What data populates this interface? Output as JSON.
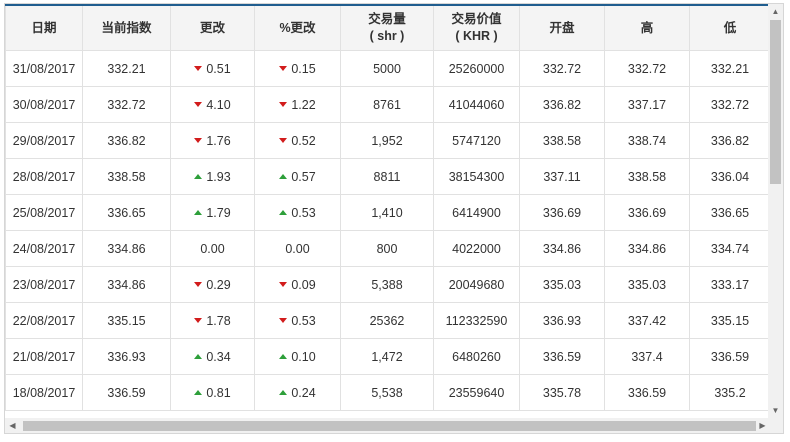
{
  "columns": [
    {
      "line1": "日期",
      "line2": ""
    },
    {
      "line1": "当前指数",
      "line2": ""
    },
    {
      "line1": "更改",
      "line2": ""
    },
    {
      "line1": "%更改",
      "line2": ""
    },
    {
      "line1": "交易量",
      "line2": "( shr )"
    },
    {
      "line1": "交易价值",
      "line2": "( KHR )"
    },
    {
      "line1": "开盘",
      "line2": ""
    },
    {
      "line1": "高",
      "line2": ""
    },
    {
      "line1": "低",
      "line2": ""
    }
  ],
  "rows": [
    {
      "date": "31/08/2017",
      "index": "332.21",
      "dir": "down",
      "change": "0.51",
      "pct": "0.15",
      "volume": "5000",
      "value": "25260000",
      "open": "332.72",
      "high": "332.72",
      "low": "332.21"
    },
    {
      "date": "30/08/2017",
      "index": "332.72",
      "dir": "down",
      "change": "4.10",
      "pct": "1.22",
      "volume": "8761",
      "value": "41044060",
      "open": "336.82",
      "high": "337.17",
      "low": "332.72"
    },
    {
      "date": "29/08/2017",
      "index": "336.82",
      "dir": "down",
      "change": "1.76",
      "pct": "0.52",
      "volume": "1,952",
      "value": "5747120",
      "open": "338.58",
      "high": "338.74",
      "low": "336.82"
    },
    {
      "date": "28/08/2017",
      "index": "338.58",
      "dir": "up",
      "change": "1.93",
      "pct": "0.57",
      "volume": "8811",
      "value": "38154300",
      "open": "337.11",
      "high": "338.58",
      "low": "336.04"
    },
    {
      "date": "25/08/2017",
      "index": "336.65",
      "dir": "up",
      "change": "1.79",
      "pct": "0.53",
      "volume": "1,410",
      "value": "6414900",
      "open": "336.69",
      "high": "336.69",
      "low": "336.65"
    },
    {
      "date": "24/08/2017",
      "index": "334.86",
      "dir": "none",
      "change": "0.00",
      "pct": "0.00",
      "volume": "800",
      "value": "4022000",
      "open": "334.86",
      "high": "334.86",
      "low": "334.74"
    },
    {
      "date": "23/08/2017",
      "index": "334.86",
      "dir": "down",
      "change": "0.29",
      "pct": "0.09",
      "volume": "5,388",
      "value": "20049680",
      "open": "335.03",
      "high": "335.03",
      "low": "333.17"
    },
    {
      "date": "22/08/2017",
      "index": "335.15",
      "dir": "down",
      "change": "1.78",
      "pct": "0.53",
      "volume": "25362",
      "value": "112332590",
      "open": "336.93",
      "high": "337.42",
      "low": "335.15"
    },
    {
      "date": "21/08/2017",
      "index": "336.93",
      "dir": "up",
      "change": "0.34",
      "pct": "0.10",
      "volume": "1,472",
      "value": "6480260",
      "open": "336.59",
      "high": "337.4",
      "low": "336.59"
    },
    {
      "date": "18/08/2017",
      "index": "336.59",
      "dir": "up",
      "change": "0.81",
      "pct": "0.24",
      "volume": "5,538",
      "value": "23559640",
      "open": "335.78",
      "high": "336.59",
      "low": "335.2"
    }
  ],
  "colors": {
    "down": "#d21c1c",
    "up": "#2e9f3a",
    "header_border": "#1f5d8f"
  }
}
